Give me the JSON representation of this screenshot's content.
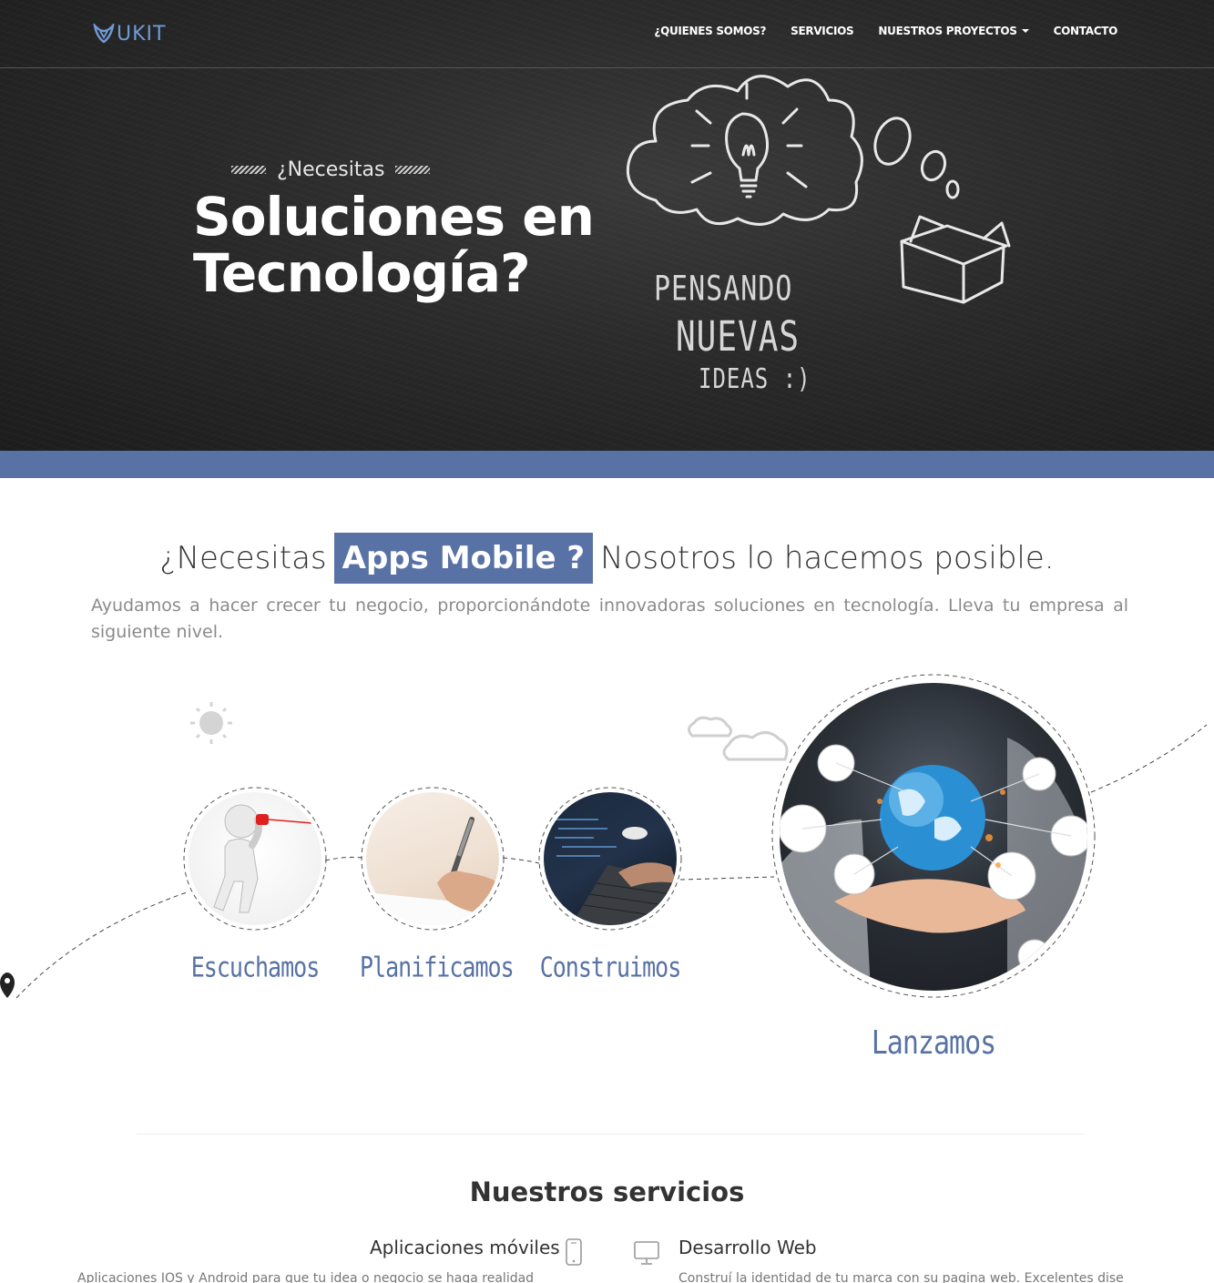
{
  "brand": {
    "name": "UKIT"
  },
  "nav": {
    "items": [
      {
        "label": "¿QUIENES SOMOS?"
      },
      {
        "label": "SERVICIOS"
      },
      {
        "label": "NUESTROS PROYECTOS"
      },
      {
        "label": "CONTACTO"
      }
    ]
  },
  "hero": {
    "kicker": "¿Necesitas",
    "title_line1": "Soluciones en",
    "title_line2": "Tecnología?",
    "chalk_line1": "PENSANDO",
    "chalk_line2": "NUEVAS",
    "chalk_line3": "IDEAS :)"
  },
  "intro": {
    "heading_before": "¿Necesitas",
    "heading_highlight": "Apps Mobile ?",
    "heading_after": "Nosotros lo hacemos posible.",
    "text": "Ayudamos a hacer crecer tu negocio, proporcionándote innovadoras soluciones en tecnología. Lleva tu empresa al siguiente nivel."
  },
  "process": {
    "steps": [
      {
        "label": "Escuchamos"
      },
      {
        "label": "Planificamos"
      },
      {
        "label": "Construimos"
      },
      {
        "label": "Lanzamos"
      }
    ]
  },
  "services": {
    "title_light": "Nuestros",
    "title_bold": "servicios",
    "items": [
      {
        "title": "Aplicaciones móviles",
        "desc": "Aplicaciones IOS y Android para que tu idea o negocio se haga realidad",
        "icon": "mobile-phone-icon"
      },
      {
        "title": "Desarrollo Web",
        "desc": "Construí la identidad de tu marca con su pagina web. Excelentes diseños y",
        "icon": "monitor-icon"
      }
    ]
  },
  "colors": {
    "accent": "#5872a6",
    "hero_bg": "#2a2a2a",
    "logo": "#6f9bd6"
  }
}
